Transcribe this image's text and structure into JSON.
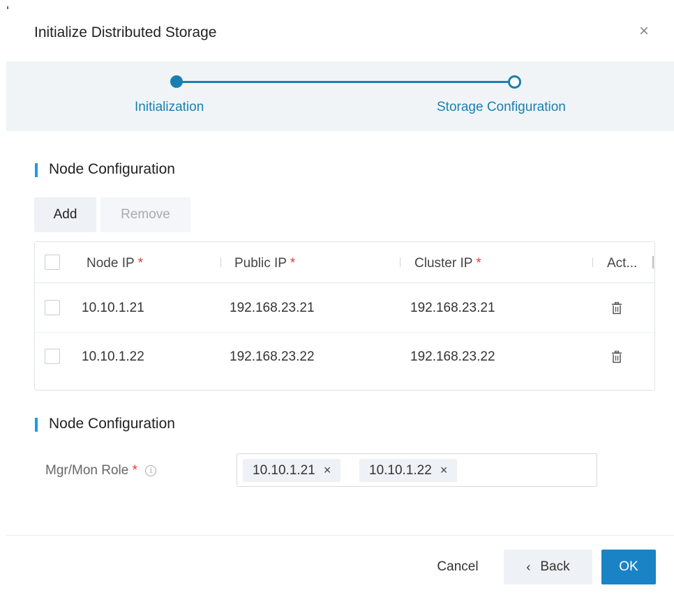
{
  "dialog": {
    "title": "Initialize Distributed Storage",
    "close_glyph": "×"
  },
  "steps": [
    {
      "label": "Initialization",
      "state": "completed"
    },
    {
      "label": "Storage Configuration",
      "state": "current"
    }
  ],
  "sections": {
    "nodes_title": "Node Configuration",
    "roles_title": "Node Configuration"
  },
  "toolbar": {
    "add_label": "Add",
    "remove_label": "Remove"
  },
  "table": {
    "columns": [
      {
        "label": "Node IP",
        "required": "*"
      },
      {
        "label": "Public IP",
        "required": "*"
      },
      {
        "label": "Cluster IP",
        "required": "*"
      },
      {
        "label": "Act...",
        "required": ""
      }
    ],
    "rows": [
      {
        "node_ip": "10.10.1.21",
        "public_ip": "192.168.23.21",
        "cluster_ip": "192.168.23.21",
        "action_icon": "trash-icon"
      },
      {
        "node_ip": "10.10.1.22",
        "public_ip": "192.168.23.22",
        "cluster_ip": "192.168.23.22",
        "action_icon": "trash-icon"
      }
    ]
  },
  "role_field": {
    "label": "Mgr/Mon Role",
    "required": "*",
    "info_glyph": "i",
    "tags": [
      "10.10.1.21",
      "10.10.1.22"
    ],
    "tag_remove_glyph": "×"
  },
  "footer": {
    "cancel_label": "Cancel",
    "back_chevron": "‹",
    "back_label": "Back",
    "ok_label": "OK"
  },
  "colors": {
    "accent": "#1a7fb0",
    "primary_button": "#1a83c6",
    "required": "#e53935",
    "section_bar": "#1a9be6"
  }
}
